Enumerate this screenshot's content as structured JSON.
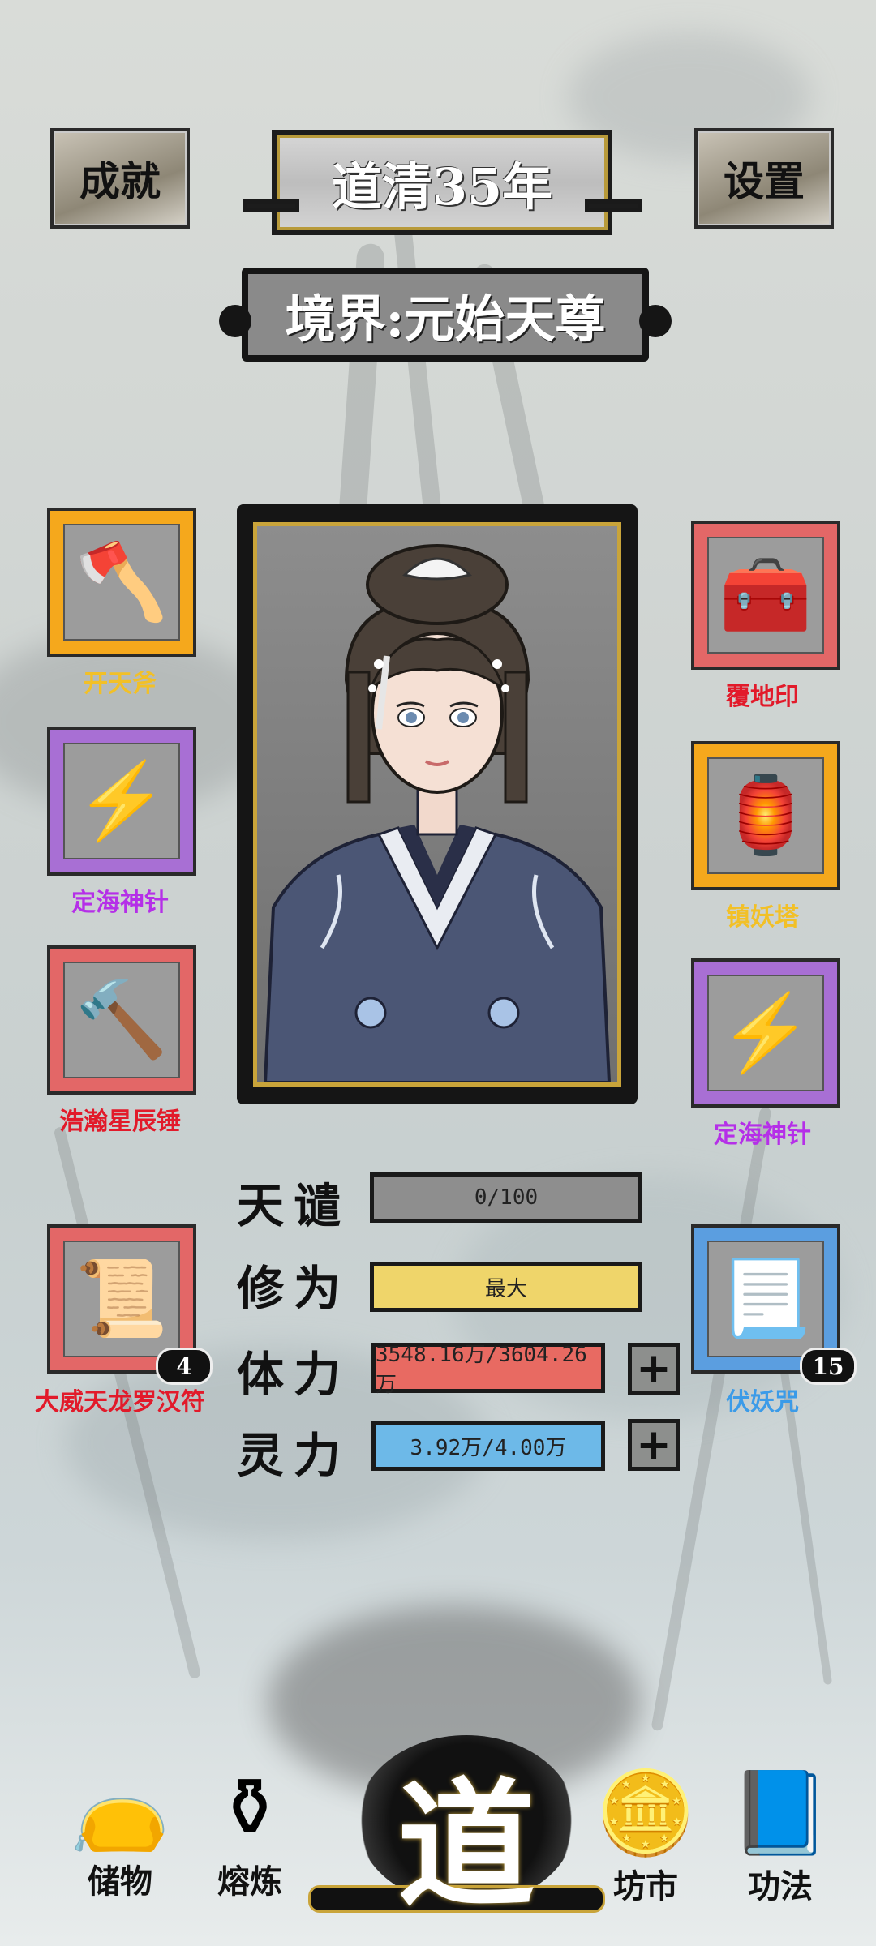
{
  "header": {
    "achievements_label": "成就",
    "year_title": "道清35年",
    "settings_label": "设置",
    "realm_title": "境界:元始天尊"
  },
  "equipment_left": [
    {
      "name": "开天斧",
      "icon": "battle-axe-icon",
      "frame_color": "#f5a81c",
      "label_color": "#f2c027"
    },
    {
      "name": "定海神针",
      "icon": "lightning-spear-icon",
      "frame_color": "#a86fd4",
      "label_color": "#b52fe8"
    },
    {
      "name": "浩瀚星辰锤",
      "icon": "hammer-icon",
      "frame_color": "#e36767",
      "label_color": "#e21a2a"
    },
    {
      "name": "大威天龙罗汉符",
      "icon": "talisman-scroll-icon",
      "frame_color": "#e36767",
      "label_color": "#e21a2a",
      "count": "4"
    }
  ],
  "equipment_right": [
    {
      "name": "覆地印",
      "icon": "treasure-seal-icon",
      "frame_color": "#e36767",
      "label_color": "#e21a2a"
    },
    {
      "name": "镇妖塔",
      "icon": "pagoda-lantern-icon",
      "frame_color": "#f5a81c",
      "label_color": "#f2c027"
    },
    {
      "name": "定海神针",
      "icon": "lightning-spear-icon",
      "frame_color": "#a86fd4",
      "label_color": "#b52fe8"
    },
    {
      "name": "伏妖咒",
      "icon": "talisman-paper-icon",
      "frame_color": "#5b9ee0",
      "label_color": "#3b9be8",
      "count": "15"
    }
  ],
  "stats": {
    "tianqian": {
      "label": "天谴",
      "value": "0/100",
      "color": "#8e8e8e"
    },
    "xiuwei": {
      "label": "修为",
      "value": "最大",
      "color": "#efd56a"
    },
    "tili": {
      "label": "体力",
      "value": "3548.16万/3604.26万",
      "color": "#e86a62"
    },
    "lingli": {
      "label": "灵力",
      "value": "3.92万/4.00万",
      "color": "#6db9e8"
    }
  },
  "nav": {
    "storage": {
      "label": "储物",
      "icon": "bag-icon"
    },
    "refine": {
      "label": "熔炼",
      "icon": "cauldron-icon"
    },
    "dao": {
      "label": "道"
    },
    "market": {
      "label": "坊市",
      "icon": "coins-icon"
    },
    "skills": {
      "label": "功法",
      "icon": "book-icon"
    }
  }
}
